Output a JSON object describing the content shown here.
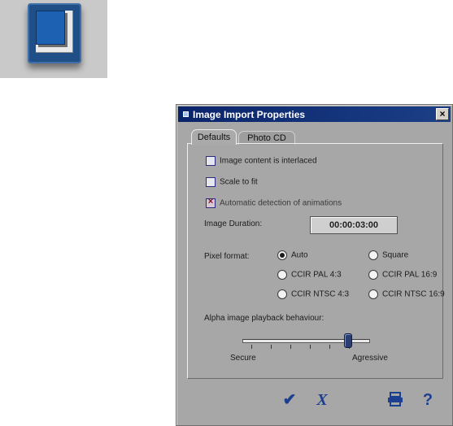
{
  "dialog": {
    "title": "Image Import Properties",
    "close_label": "×"
  },
  "tabs": [
    {
      "label": "Defaults"
    },
    {
      "label": "Photo CD"
    }
  ],
  "options": {
    "interlaced": {
      "label": "Image content is interlaced",
      "checked": false
    },
    "scale_to_fit": {
      "label": "Scale to fit",
      "checked": false
    },
    "auto_detect": {
      "label": "Automatic detection of animations",
      "checked": true,
      "mark": "×"
    }
  },
  "image_duration": {
    "label": "Image Duration:",
    "value": "00:00:03:00"
  },
  "pixel_format": {
    "label": "Pixel format:",
    "options": [
      {
        "label": "Auto",
        "selected": true
      },
      {
        "label": "Square",
        "selected": false
      },
      {
        "label": "CCIR PAL 4:3",
        "selected": false
      },
      {
        "label": "CCIR PAL 16:9",
        "selected": false
      },
      {
        "label": "CCIR NTSC 4:3",
        "selected": false
      },
      {
        "label": "CCIR NTSC 16:9",
        "selected": false
      }
    ]
  },
  "alpha_playback": {
    "label": "Alpha image playback behaviour:",
    "min_label": "Secure",
    "max_label": "Agressive",
    "level": 0.83
  },
  "footer": {
    "ok_icon": "checkmark-icon",
    "ok_glyph": "✔",
    "cancel_icon": "x-icon",
    "cancel_glyph": "X",
    "print_icon": "printer-icon",
    "help_icon": "help-icon",
    "help_glyph": "?"
  },
  "colors": {
    "dialog_bg": "#a7a7a7",
    "titlebar": "#0a246a",
    "accent": "#1d3f8f"
  }
}
